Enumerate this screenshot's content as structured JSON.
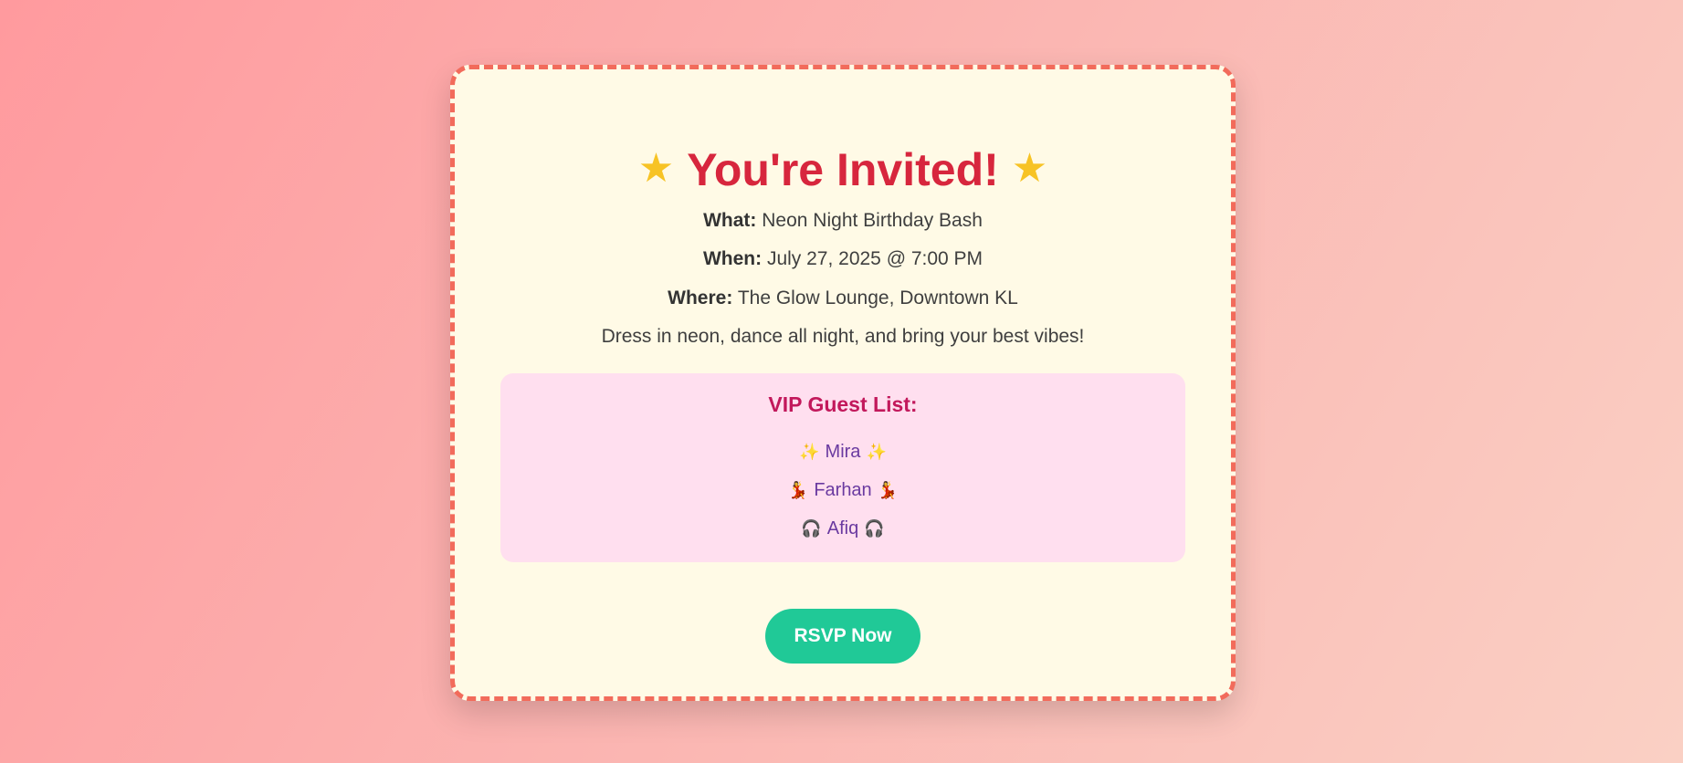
{
  "invite": {
    "title": "You're Invited!",
    "title_icon": "star-icon",
    "what_label": "What:",
    "what_value": "Neon Night Birthday Bash",
    "when_label": "When:",
    "when_value": "July 27, 2025 @ 7:00 PM",
    "where_label": "Where:",
    "where_value": "The Glow Lounge, Downtown KL",
    "tagline": "Dress in neon, dance all night, and bring your best vibes!"
  },
  "guests": {
    "title": "VIP Guest List:",
    "items": [
      {
        "name": "Mira",
        "icon": "sparkles-icon",
        "glyph": "✨"
      },
      {
        "name": "Farhan",
        "icon": "dancer-icon",
        "glyph": "💃"
      },
      {
        "name": "Afiq",
        "icon": "headphones-icon",
        "glyph": "🎧"
      }
    ]
  },
  "rsvp": {
    "label": "RSVP Now"
  },
  "colors": {
    "title": "#d7263d",
    "button": "#20c997",
    "card_border": "#f26b5b",
    "guest_box": "#ffdfef",
    "guest_name": "#6a3aa0"
  }
}
